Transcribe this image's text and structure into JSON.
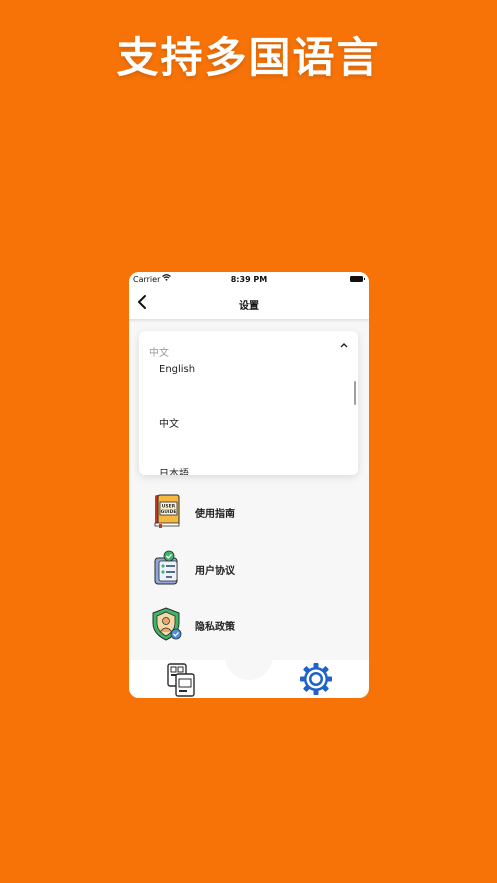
{
  "headline": "支持多国语言",
  "status_bar": {
    "carrier": "Carrier",
    "time": "8:39 PM"
  },
  "navbar": {
    "back_icon": "chevron-left-icon",
    "title": "设置"
  },
  "language_dropdown": {
    "selected": "中文",
    "chevron_icon": "chevron-up-icon",
    "options": [
      "English",
      "中文",
      "日本語"
    ]
  },
  "menu": [
    {
      "label": "使用指南",
      "icon": "user-guide-book-icon"
    },
    {
      "label": "用户协议",
      "icon": "clipboard-checklist-icon"
    },
    {
      "label": "隐私政策",
      "icon": "privacy-shield-icon"
    }
  ],
  "tab_bar": {
    "items": [
      {
        "icon": "image-translate-icon"
      },
      {
        "icon": "gear-icon",
        "active": true
      }
    ]
  },
  "colors": {
    "background": "#f77307",
    "accent": "#1e63c9"
  }
}
